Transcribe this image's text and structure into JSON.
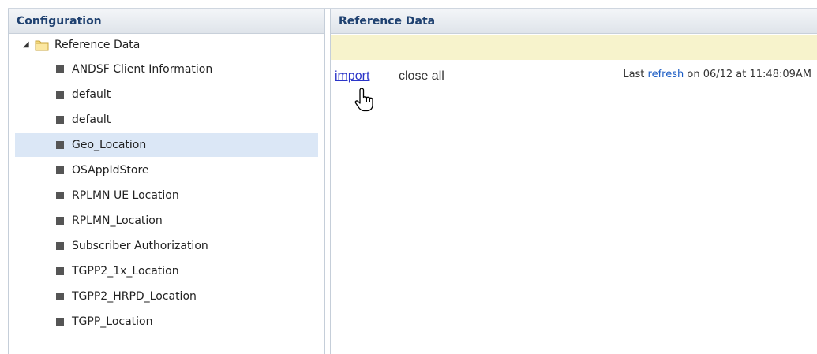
{
  "left_panel": {
    "title": "Configuration",
    "root": {
      "label": "Reference Data",
      "icon": "folder-icon",
      "expanded": true
    },
    "items": [
      {
        "label": "ANDSF Client Information"
      },
      {
        "label": "default"
      },
      {
        "label": "default"
      },
      {
        "label": "Geo_Location",
        "selected": true
      },
      {
        "label": "OSAppIdStore"
      },
      {
        "label": "RPLMN UE Location"
      },
      {
        "label": "RPLMN_Location"
      },
      {
        "label": "Subscriber Authorization"
      },
      {
        "label": "TGPP2_1x_Location"
      },
      {
        "label": "TGPP2_HRPD_Location"
      },
      {
        "label": "TGPP_Location"
      }
    ]
  },
  "right_panel": {
    "title": "Reference Data",
    "import_label": "import",
    "close_all_label": "close all",
    "last_refresh": {
      "prefix": "Last ",
      "link": "refresh",
      "suffix": " on 06/12 at 11:48:09AM"
    }
  },
  "colors": {
    "header_text": "#1f4170",
    "selected_row": "#dbe7f6",
    "yellow_bar": "#f7f3cc",
    "link": "#2b35c8"
  }
}
